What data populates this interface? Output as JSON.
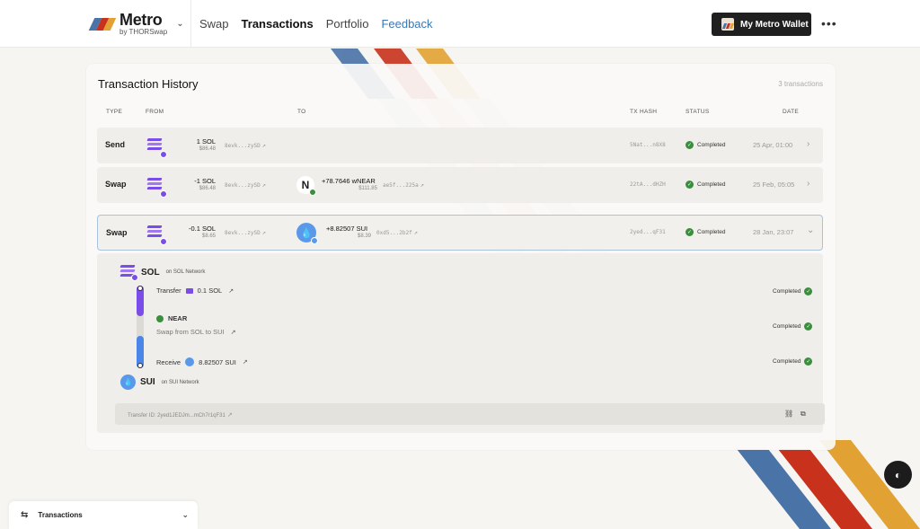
{
  "brand": {
    "title": "Metro",
    "subtitle": "by THORSwap"
  },
  "nav": [
    {
      "label": "Swap"
    },
    {
      "label": "Transactions"
    },
    {
      "label": "Portfolio"
    },
    {
      "label": "Feedback"
    }
  ],
  "wallet_button": "My Metro Wallet",
  "more": "•••",
  "history": {
    "title": "Transaction History",
    "count": "3 transactions",
    "headers": {
      "type": "TYPE",
      "from": "FROM",
      "to": "TO",
      "hash": "TX HASH",
      "status": "STATUS",
      "date": "DATE"
    },
    "rows": [
      {
        "type": "Send",
        "from_amount": "1 SOL",
        "from_usd": "$86.48",
        "from_addr": "8evk...zySD",
        "to_amount": "",
        "to_usd": "",
        "to_addr": "",
        "hash": "5Nat...n8X8",
        "status": "Completed",
        "date": "25 Apr, 01:00"
      },
      {
        "type": "Swap",
        "from_amount": "-1 SOL",
        "from_usd": "$86.48",
        "from_addr": "8evk...zySD",
        "to_amount": "+78.7646 wNEAR",
        "to_usd": "$111.85",
        "to_addr": "ae5f...225a",
        "hash": "22tA...dHZH",
        "status": "Completed",
        "date": "25 Feb, 05:05"
      },
      {
        "type": "Swap",
        "from_amount": "-0.1 SOL",
        "from_usd": "$8.65",
        "from_addr": "8evk...zySD",
        "to_amount": "+8.82507 SUI",
        "to_usd": "$8.39",
        "to_addr": "0xd5...2b2f",
        "hash": "2yed...qF31",
        "status": "Completed",
        "date": "28 Jan, 23:07"
      }
    ]
  },
  "detail": {
    "source_network": {
      "name": "SOL",
      "sub": "on SOL Network"
    },
    "steps": [
      {
        "label": "Transfer",
        "amount": "0.1",
        "token": "SOL",
        "status": "Completed"
      },
      {
        "label": "NEAR",
        "sub": "Swap from SOL to SUI",
        "status": "Completed"
      },
      {
        "label": "Receive",
        "amount": "8.82507",
        "token": "SUI",
        "status": "Completed"
      }
    ],
    "dest_network": {
      "name": "SUI",
      "sub": "on SUI Network"
    },
    "transfer_id": "Transfer ID: 2yed1JEDJm...mCh7r1qF31"
  },
  "bottom_panel": {
    "label": "Transactions"
  },
  "colors": {
    "blue": "#4a73a8",
    "red": "#c8321c",
    "orange": "#e2a233",
    "sol_purple": "#7a4de8",
    "sui_blue": "#5a99ea",
    "success": "#3a8f3c"
  }
}
